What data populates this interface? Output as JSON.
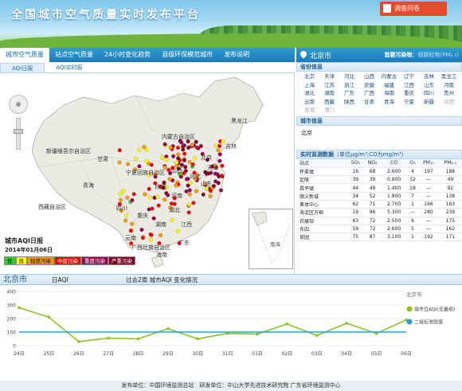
{
  "header": {
    "title": "全国城市空气质量实时发布平台",
    "survey_button": "调查问卷"
  },
  "nav": {
    "tabs": [
      "城市空气质量",
      "站点空气质量",
      "24小时变化趋势",
      "县级环保模范城市",
      "发布说明"
    ],
    "active": 0
  },
  "map_tabs": [
    "AQI日报",
    "AQI实时报"
  ],
  "map": {
    "regions": [
      "黑龙江",
      "吉林",
      "内蒙古自治区",
      "新疆维吾尔自治区",
      "甘肃",
      "宁夏回族自治区",
      "北京",
      "天津",
      "河北",
      "山西",
      "山东",
      "青海",
      "陕西",
      "河南",
      "西藏自治区",
      "四川",
      "重庆",
      "湖北",
      "湖南",
      "江西",
      "云南",
      "广西壮族自治区",
      "广东",
      "海南"
    ],
    "inset_label": "南海",
    "aqi_title": "城市AQI日报",
    "aqi_date": "2014年01月06日",
    "legend": [
      {
        "label": "优",
        "color": "#33cc33"
      },
      {
        "label": "良",
        "color": "#ffff00"
      },
      {
        "label": "轻度污染",
        "color": "#ff9900"
      },
      {
        "label": "中度污染",
        "color": "#ff0000"
      },
      {
        "label": "重度污染",
        "color": "#99004c"
      },
      {
        "label": "严重污染",
        "color": "#7e0023"
      }
    ]
  },
  "right": {
    "city": "北京市",
    "primary_pollutant_label": "首要污染物：",
    "primary_pollutant_value": "细颗粒物(PM₂.₅)",
    "province_title": "省份信息",
    "provinces": [
      "北京",
      "天津",
      "河北",
      "山西",
      "内蒙古",
      "辽宁",
      "吉林",
      "黑龙江",
      "上海",
      "江苏",
      "浙江",
      "安徽",
      "福建",
      "江西",
      "山东",
      "河南",
      "湖北",
      "湖南",
      "广东",
      "广西",
      "海南",
      "重庆",
      "四川",
      "贵州",
      "云南",
      "西藏",
      "陕西",
      "甘肃",
      "青海",
      "宁夏",
      "新疆",
      "兵团",
      "香港",
      "澳门"
    ],
    "provinces_disabled": [
      "兵团",
      "香港",
      "澳门"
    ],
    "city_info_title": "城市信息",
    "city_info_value": "北京",
    "monitor_title": "实时监测数据",
    "monitor_unit": "（单位μg/m³;CO为mg/m³）",
    "columns": [
      "站点",
      "SO₂",
      "NO₂",
      "CO",
      "O₃",
      "PM₁₀",
      "PM₂.₅"
    ],
    "rows": [
      [
        "怀柔镇",
        "16",
        "68",
        "2.600",
        "4",
        "197",
        "188"
      ],
      [
        "定陵",
        "39",
        "39",
        "0.800",
        "32",
        "—",
        "49"
      ],
      [
        "昌平镇",
        "44",
        "49",
        "1.400",
        "18",
        "—",
        "92"
      ],
      [
        "顺义新城",
        "34",
        "52",
        "1.800",
        "7",
        "—",
        "138"
      ],
      [
        "奥体中心",
        "62",
        "71",
        "2.700",
        "1",
        "166",
        "163"
      ],
      [
        "海淀区万柳",
        "19",
        "96",
        "5.300",
        "—",
        "280",
        "239"
      ],
      [
        "农展馆",
        "63",
        "72",
        "2.500",
        "6",
        "—",
        "175"
      ],
      [
        "东四",
        "59",
        "72",
        "2.600",
        "5",
        "—",
        "162"
      ],
      [
        "官园",
        "75",
        "87",
        "3.100",
        "1",
        "192",
        "171"
      ]
    ]
  },
  "chart_bar": {
    "city": "北京市",
    "tab_daily": "日AQI",
    "tab_trend": "过去2周 城市AQI 变化情况"
  },
  "chart_data": {
    "type": "line",
    "title": "北京市",
    "categories": [
      "24日",
      "25日",
      "26日",
      "27日",
      "28日",
      "29日",
      "30日",
      "31日",
      "01日",
      "02日",
      "03日",
      "04日",
      "05日",
      "06日"
    ],
    "series": [
      {
        "name": "城市日AQI(无量纲)",
        "color": "#8dc21f",
        "values": [
          280,
          210,
          30,
          55,
          50,
          125,
          50,
          90,
          85,
          160,
          75,
          165,
          90,
          190
        ]
      },
      {
        "name": "二级标准限值",
        "color": "#2aa1d8",
        "values": [
          100,
          100,
          100,
          100,
          100,
          100,
          100,
          100,
          100,
          100,
          100,
          100,
          100,
          100
        ]
      }
    ],
    "ylim": [
      0,
      400
    ],
    "yticks": [
      0,
      100,
      200,
      300,
      400
    ],
    "grid": true,
    "legend_position": "top-right"
  },
  "footer": "发布单位：中国环境监测总站　研发单位：中山大学先进技术研究院 广东省环境监测中心"
}
